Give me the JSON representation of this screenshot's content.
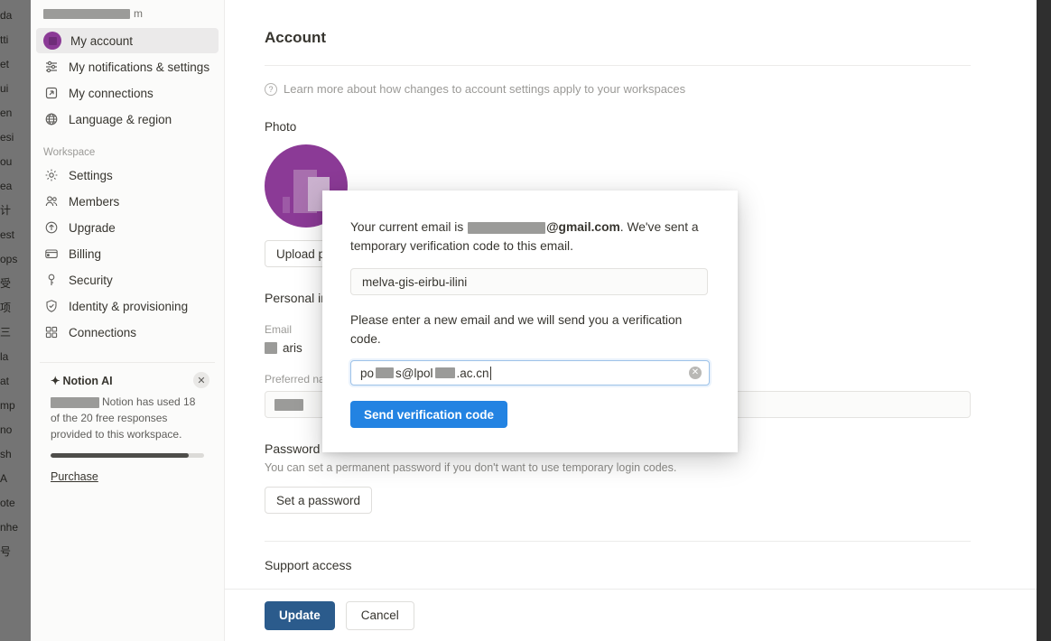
{
  "background_page": {
    "edge_text_lines": [
      "da",
      "tti",
      "et",
      "ui",
      "en",
      "esi",
      "ou",
      "ea",
      "计",
      "est",
      "ops",
      "受",
      "项",
      "三",
      "la",
      "at",
      "mp",
      "no",
      "sh",
      "A",
      "ote",
      "nhe",
      "号"
    ]
  },
  "sidebar": {
    "account_email_suffix": "m",
    "account_items": [
      {
        "label": "My account",
        "icon": "avatar-icon",
        "active": true
      },
      {
        "label": "My notifications & settings",
        "icon": "sliders-icon",
        "active": false
      },
      {
        "label": "My connections",
        "icon": "arrow-out-square-icon",
        "active": false
      },
      {
        "label": "Language & region",
        "icon": "globe-icon",
        "active": false
      }
    ],
    "workspace_section_label": "Workspace",
    "workspace_items": [
      {
        "label": "Settings",
        "icon": "gear-icon"
      },
      {
        "label": "Members",
        "icon": "people-icon"
      },
      {
        "label": "Upgrade",
        "icon": "arrow-up-circle-icon"
      },
      {
        "label": "Billing",
        "icon": "credit-card-icon"
      },
      {
        "label": "Security",
        "icon": "key-icon"
      },
      {
        "label": "Identity & provisioning",
        "icon": "shield-check-icon"
      },
      {
        "label": "Connections",
        "icon": "grid-icon"
      }
    ],
    "ai_card": {
      "title": "Notion AI",
      "sparkle_icon": "sparkle-icon",
      "body": "Notion has used 18 of the 20 free responses provided to this workspace.",
      "used": 18,
      "total": 20,
      "progress_percent": 90,
      "purchase_label": "Purchase",
      "close_icon": "close-icon"
    }
  },
  "content": {
    "title": "Account",
    "note": "Learn more about how changes to account settings apply to your workspaces",
    "note_icon": "info-icon",
    "photo_label": "Photo",
    "upload_label": "Upload photo",
    "personal_info_label": "Personal info",
    "email_label": "Email",
    "email_value": "aris",
    "preferred_name_label": "Preferred name",
    "password_label": "Password",
    "password_desc": "You can set a permanent password if you don't want to use temporary login codes.",
    "set_password_label": "Set a password",
    "support_access_label": "Support access"
  },
  "action_bar": {
    "update_label": "Update",
    "cancel_label": "Cancel"
  },
  "modal": {
    "intro_prefix": "Your current email is",
    "intro_domain": "@gmail.com",
    "intro_suffix": ". We've sent a temporary verification code to this email.",
    "code_value": "melva-gis-eirbu-ilini",
    "instruction": "Please enter a new email and we will send you a verification code.",
    "new_email_prefix": "po",
    "new_email_middle": "s@lpol",
    "new_email_suffix": ".ac.cn",
    "clear_icon": "clear-circle-icon",
    "send_button_label": "Send verification code"
  },
  "colors": {
    "accent_blue": "#2383e2",
    "update_blue": "#2b5b8c",
    "avatar_purple": "#8b3a96",
    "sidebar_bg": "#fbfbfa",
    "text_primary": "#37352f",
    "text_muted": "#9b9a97"
  }
}
